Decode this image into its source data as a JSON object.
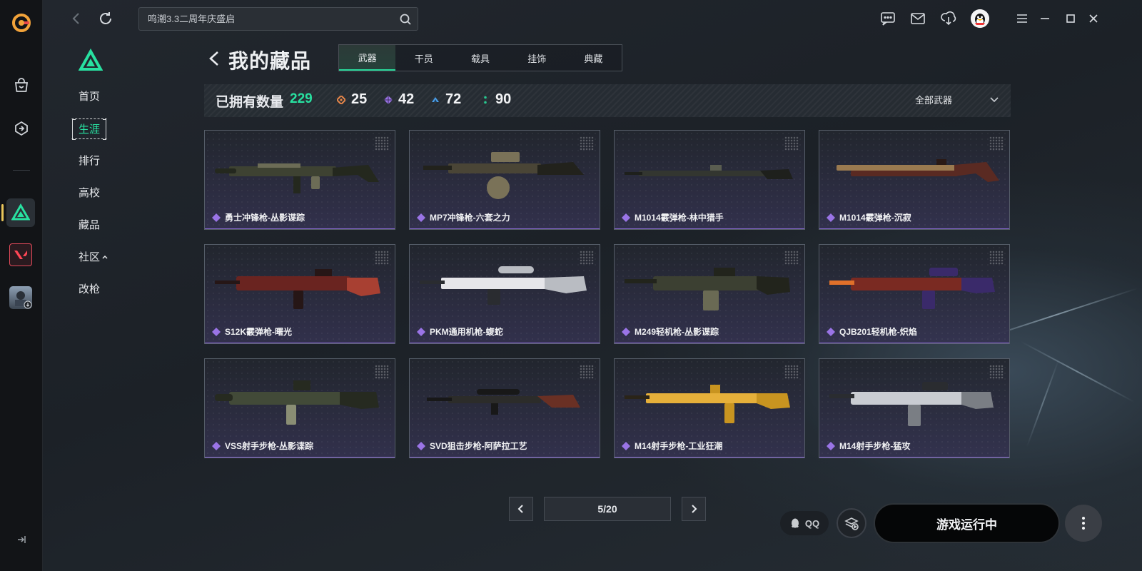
{
  "top": {
    "search_value": "鸣潮3.3二周年庆盛启"
  },
  "sidebar_nav": {
    "items": [
      {
        "label": "首页",
        "active": false
      },
      {
        "label": "生涯",
        "active": true
      },
      {
        "label": "排行",
        "active": false
      },
      {
        "label": "高校",
        "active": false
      },
      {
        "label": "藏品",
        "active": false
      },
      {
        "label": "社区",
        "active": false
      },
      {
        "label": "改枪",
        "active": false
      }
    ]
  },
  "header": {
    "title": "我的藏品",
    "tabs": [
      {
        "label": "武器",
        "active": true
      },
      {
        "label": "干员",
        "active": false
      },
      {
        "label": "载具",
        "active": false
      },
      {
        "label": "挂饰",
        "active": false
      },
      {
        "label": "典藏",
        "active": false
      }
    ]
  },
  "stats": {
    "owned_label": "已拥有数量",
    "owned_total": "229",
    "rarities": [
      {
        "icon": "orange-diamond-icon",
        "value": "25",
        "color": "#e8874a"
      },
      {
        "icon": "purple-diamond-icon",
        "value": "42",
        "color": "#9a74e6"
      },
      {
        "icon": "blue-diamond-icon",
        "value": "72",
        "color": "#4a9ee8"
      },
      {
        "icon": "green-dot-icon",
        "value": "90",
        "color": "#28c890"
      }
    ],
    "filter_label": "全部武器"
  },
  "weapons": [
    {
      "name": "勇士冲锋枪-丛影谍踪",
      "rarity_color": "#9a74e6",
      "palette": [
        "#3e4232",
        "#6c6c56",
        "#24281e"
      ]
    },
    {
      "name": "MP7冲锋枪-六套之力",
      "rarity_color": "#9a74e6",
      "palette": [
        "#4a4536",
        "#7a7258",
        "#22221c"
      ]
    },
    {
      "name": "M1014霰弹枪-林中猎手",
      "rarity_color": "#9a74e6",
      "palette": [
        "#333630",
        "#5a5d50",
        "#1e201c"
      ]
    },
    {
      "name": "M1014霰弹枪-沉寂",
      "rarity_color": "#9a74e6",
      "palette": [
        "#5a2a22",
        "#9a7a50",
        "#2a1a16"
      ]
    },
    {
      "name": "S12K霰弹枪-曙光",
      "rarity_color": "#9a74e6",
      "palette": [
        "#6a2420",
        "#a84032",
        "#261616"
      ]
    },
    {
      "name": "PKM通用机枪-蝮蛇",
      "rarity_color": "#9a74e6",
      "palette": [
        "#b9bcc2",
        "#e6e6ea",
        "#2a2c30"
      ]
    },
    {
      "name": "M249轻机枪-丛影谍踪",
      "rarity_color": "#9a74e6",
      "palette": [
        "#3c4032",
        "#6a6a54",
        "#22241c"
      ]
    },
    {
      "name": "QJB201轻机枪-炽焰",
      "rarity_color": "#9a74e6",
      "palette": [
        "#7a2a22",
        "#e0702a",
        "#3a2a6a"
      ]
    },
    {
      "name": "VSS射手步枪-丛影谍踪",
      "rarity_color": "#9a74e6",
      "palette": [
        "#424a38",
        "#8a8e74",
        "#262a20"
      ]
    },
    {
      "name": "SVD狙击步枪-阿萨拉工艺",
      "rarity_color": "#9a74e6",
      "palette": [
        "#2c2c2a",
        "#6a3024",
        "#181818"
      ]
    },
    {
      "name": "M14射手步枪-工业狂潮",
      "rarity_color": "#9a74e6",
      "palette": [
        "#c89420",
        "#e6b03a",
        "#2a2418"
      ]
    },
    {
      "name": "M14射手步枪-猛攻",
      "rarity_color": "#9a74e6",
      "palette": [
        "#7a7e84",
        "#c9ccd2",
        "#2a2c30"
      ]
    }
  ],
  "pager": {
    "text": "5/20"
  },
  "bottom": {
    "qq_label": "QQ",
    "launch_label": "游戏运行中"
  }
}
